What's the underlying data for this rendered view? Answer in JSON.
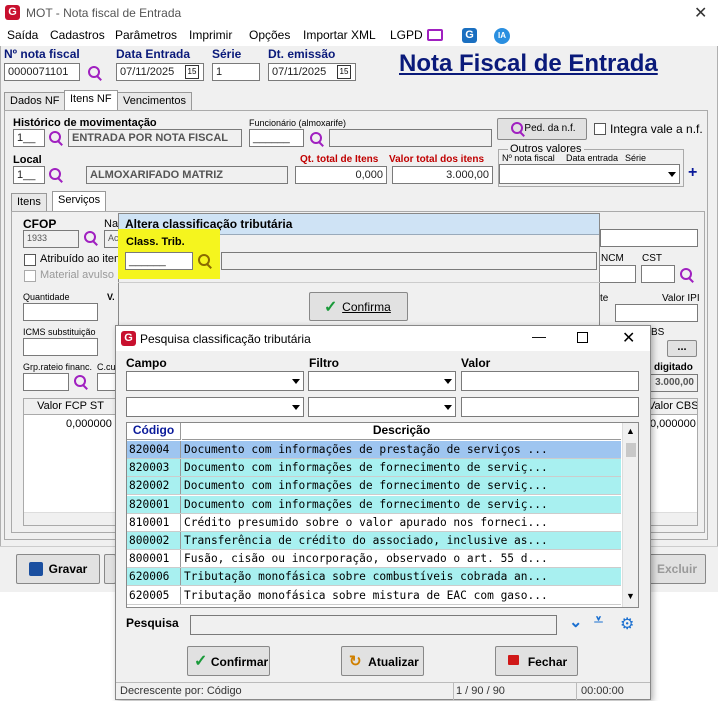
{
  "window": {
    "title": "MOT - Nota fiscal de Entrada"
  },
  "menu": [
    "Saída",
    "Cadastros",
    "Parâmetros",
    "Imprimir",
    "Opções",
    "Importar XML",
    "LGPD"
  ],
  "header": {
    "nf_label": "Nº nota fiscal",
    "nf_value": "0000071101",
    "data_entrada_label": "Data Entrada",
    "data_entrada_value": "07/11/2025",
    "serie_label": "Série",
    "serie_value": "1",
    "dt_emissao_label": "Dt. emissão",
    "dt_emissao_value": "07/11/2025",
    "page_title": "Nota Fiscal de Entrada",
    "cal_glyph": "15"
  },
  "tabs": [
    "Dados NF",
    "Itens NF",
    "Vencimentos"
  ],
  "itens": {
    "historico_label": "Histórico de movimentação",
    "historico_code": "1__",
    "historico_desc": "ENTRADA POR NOTA FISCAL",
    "funcionario_label": "Funcionário (almoxarife)",
    "funcionario_value": "______",
    "ped_button": "Ped. da n.f.",
    "integra_label": "Integra vale a n.f.",
    "local_label": "Local",
    "local_code": "1__",
    "local_desc": "ALMOXARIFADO MATRIZ",
    "qt_total_label": "Qt. total de Itens",
    "qt_total_value": "0,000",
    "valor_total_label": "Valor total dos itens",
    "valor_total_value": "3.000,00",
    "outros_label": "Outros valores",
    "outros_cols": [
      "Nº nota fiscal",
      "Data entrada",
      "Série"
    ],
    "subtabs": [
      "Itens",
      "Serviços"
    ],
    "cfop_label": "CFOP",
    "cfop_value": "1933",
    "na_label": "Na",
    "ac_value": "Ac",
    "atribuido_label": "Atribuído ao item",
    "material_label": "Material avulso",
    "quantidade_label": "Quantidade",
    "v_label": "V.",
    "icms_sub_label": "ICMS substituição",
    "grp_label": "Grp.rateio financ.",
    "ccu_label": "C.cu",
    "ncm_label": "NCM",
    "cst_label": "CST",
    "te_label": "te",
    "valor_ipi_label": "Valor IPI",
    "bs_label": "BS",
    "dots": "...",
    "digitado_label": "digitado",
    "digitado_value": "3.000,00",
    "fcp_header": "Valor FCP ST",
    "fcp_value": "0,000000",
    "cbs_header": "Valor CBS",
    "cbs_value": "0,000000"
  },
  "bottom_buttons": {
    "gravar": "Gravar",
    "excluir": "Excluir"
  },
  "altera": {
    "title": "Altera classificação tributária",
    "class_label": "Class. Trib.",
    "class_value": "______",
    "confirm": "Confirma"
  },
  "pesquisa": {
    "title": "Pesquisa classificação tributária",
    "campo_label": "Campo",
    "filtro_label": "Filtro",
    "valor_label": "Valor",
    "col_codigo": "Código",
    "col_descricao": "Descrição",
    "rows": [
      {
        "code": "820004",
        "desc": "Documento com informações de prestação de serviços ..."
      },
      {
        "code": "820003",
        "desc": "Documento com informações de fornecimento de serviç..."
      },
      {
        "code": "820002",
        "desc": "Documento com informações de fornecimento de serviç..."
      },
      {
        "code": "820001",
        "desc": "Documento com informações de fornecimento de serviç..."
      },
      {
        "code": "810001",
        "desc": "Crédito presumido sobre o valor apurado nos forneci..."
      },
      {
        "code": "800002",
        "desc": "Transferência de crédito do associado, inclusive as..."
      },
      {
        "code": "800001",
        "desc": "Fusão, cisão ou incorporação, observado o art. 55 d..."
      },
      {
        "code": "620006",
        "desc": "Tributação monofásica sobre combustíveis cobrada an..."
      },
      {
        "code": "620005",
        "desc": "Tributação monofásica sobre mistura de EAC com gaso..."
      }
    ],
    "search_label": "Pesquisa",
    "btn_confirmar": "Confirmar",
    "btn_atualizar": "Atualizar",
    "btn_fechar": "Fechar",
    "status_left": "Decrescente por: Código",
    "status_mid": "1 / 90 / 90",
    "status_right": "00:00:00"
  },
  "colors": {
    "row_highlight": "#9ec5f0",
    "row_cyan": "#a8f0f0",
    "title_blue": "#0a1a7a",
    "highlight_yellow": "#f5f51e"
  }
}
